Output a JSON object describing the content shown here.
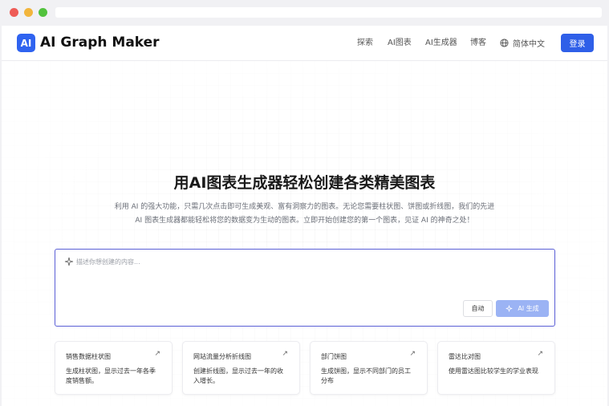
{
  "nav": {
    "brand": "AI Graph Maker",
    "logo_text": "AI",
    "links": [
      "探索",
      "AI图表",
      "AI生成器",
      "博客"
    ],
    "language": "简体中文",
    "login": "登录"
  },
  "hero": {
    "title": "用AI图表生成器轻松创建各类精美图表",
    "description": "利用 AI 的强大功能，只需几次点击即可生成美观、富有洞察力的图表。无论您需要柱状图、饼图或折线图，我们的先进 AI 图表生成器都能轻松将您的数据变为生动的图表。立即开始创建您的第一个图表，见证 AI 的神奇之处！"
  },
  "prompt": {
    "placeholder": "描述你想创建的内容...",
    "auto_label": "自动",
    "generate_label": "AI 生成"
  },
  "cards": [
    {
      "title": "销售数据柱状图",
      "desc": "生成柱状图，显示过去一年各季度销售额。"
    },
    {
      "title": "网站流量分析折线图",
      "desc": "创建折线图，显示过去一年的收入增长。"
    },
    {
      "title": "部门饼图",
      "desc": "生成饼图，显示不同部门的员工分布"
    },
    {
      "title": "雷达比对图",
      "desc": "使用雷达图比较学生的学业表现"
    }
  ],
  "icons": {
    "logo": "ai-logo-icon",
    "language": "globe-icon",
    "prompt": "sparkle-icon",
    "card_arrow": "arrow-up-right-icon"
  },
  "colors": {
    "accent": "#2f5fe8",
    "generate_disabled": "#9bb3f4",
    "prompt_border": "#5b5fd6"
  }
}
